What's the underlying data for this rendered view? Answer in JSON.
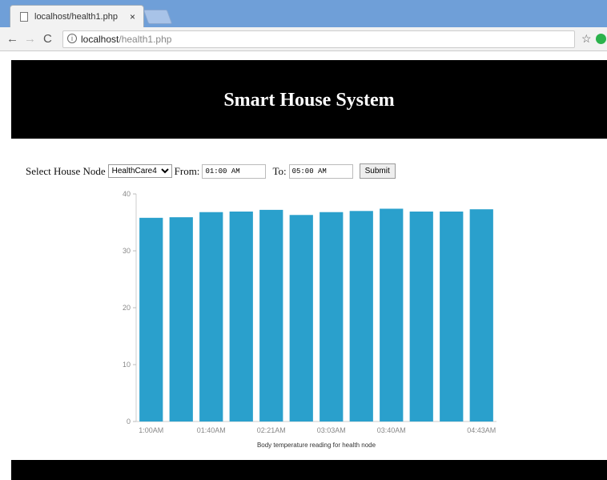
{
  "browser": {
    "tab_title": "localhost/health1.php",
    "tab_close": "×",
    "url_host": "localhost",
    "url_path": "/health1.php"
  },
  "header": {
    "title": "Smart House System"
  },
  "form": {
    "node_label": "Select House Node",
    "node_selected": "HealthCare4",
    "from_label": "From:",
    "from_value": "01:00 AM",
    "to_label": "To:",
    "to_value": "05:00 AM",
    "submit_label": "Submit"
  },
  "colors": {
    "bar": "#2aa0cc",
    "header_bg": "#000000"
  },
  "chart_data": {
    "type": "bar",
    "xlabel": "Body temperature reading for health node",
    "ylabel": "",
    "ylim": [
      0,
      40
    ],
    "yticks": [
      0,
      10,
      20,
      30,
      40
    ],
    "categories": [
      "1:00AM",
      "",
      "01:40AM",
      "",
      "02:21AM",
      "",
      "03:03AM",
      "",
      "03:40AM",
      "",
      "",
      "04:43AM"
    ],
    "values": [
      35.8,
      35.9,
      36.8,
      36.9,
      37.2,
      36.3,
      36.8,
      37.0,
      37.4,
      36.9,
      36.9,
      37.3
    ]
  }
}
